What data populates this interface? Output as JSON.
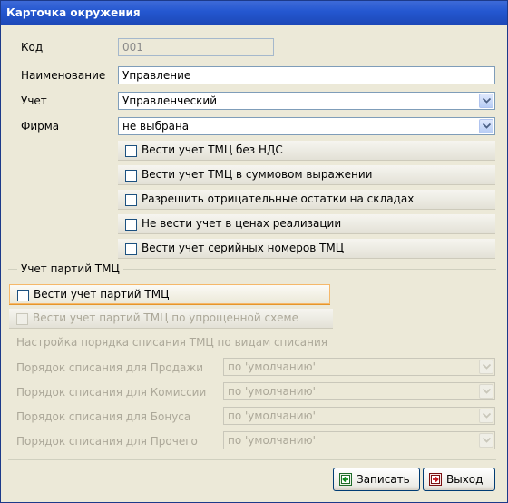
{
  "window": {
    "title": "Карточка окружения"
  },
  "form": {
    "code_label": "Код",
    "code_value": "001",
    "name_label": "Наименование",
    "name_value": "Управление",
    "accounting_label": "Учет",
    "accounting_value": "Управленческий",
    "firm_label": "Фирма",
    "firm_value": "не выбрана"
  },
  "options": [
    "Вести учет ТМЦ без НДС",
    "Вести учет ТМЦ в суммовом выражении",
    "Разрешить отрицательные остатки на складах",
    "Не вести учет в ценах реализации",
    "Вести учет серийных номеров ТМЦ"
  ],
  "batches": {
    "group_title": "Учет партий ТМЦ",
    "track_batches": "Вести учет партий ТМЦ",
    "simplified": "Вести учет партий ТМЦ по упрощенной схеме",
    "setup_title": "Настройка порядка списания ТМЦ по видам списания",
    "rows": [
      {
        "label": "Порядок списания для Продажи",
        "value": "по 'умолчанию'"
      },
      {
        "label": "Порядок списания для Комиссии",
        "value": "по 'умолчанию'"
      },
      {
        "label": "Порядок списания для Бонуса",
        "value": "по 'умолчанию'"
      },
      {
        "label": "Порядок списания для Прочего",
        "value": "по 'умолчанию'"
      }
    ]
  },
  "buttons": {
    "save": "Записать",
    "exit": "Выход"
  },
  "colors": {
    "titlebar": "#2457d0",
    "window_bg": "#ece9d8",
    "focus": "#f5b86a"
  }
}
